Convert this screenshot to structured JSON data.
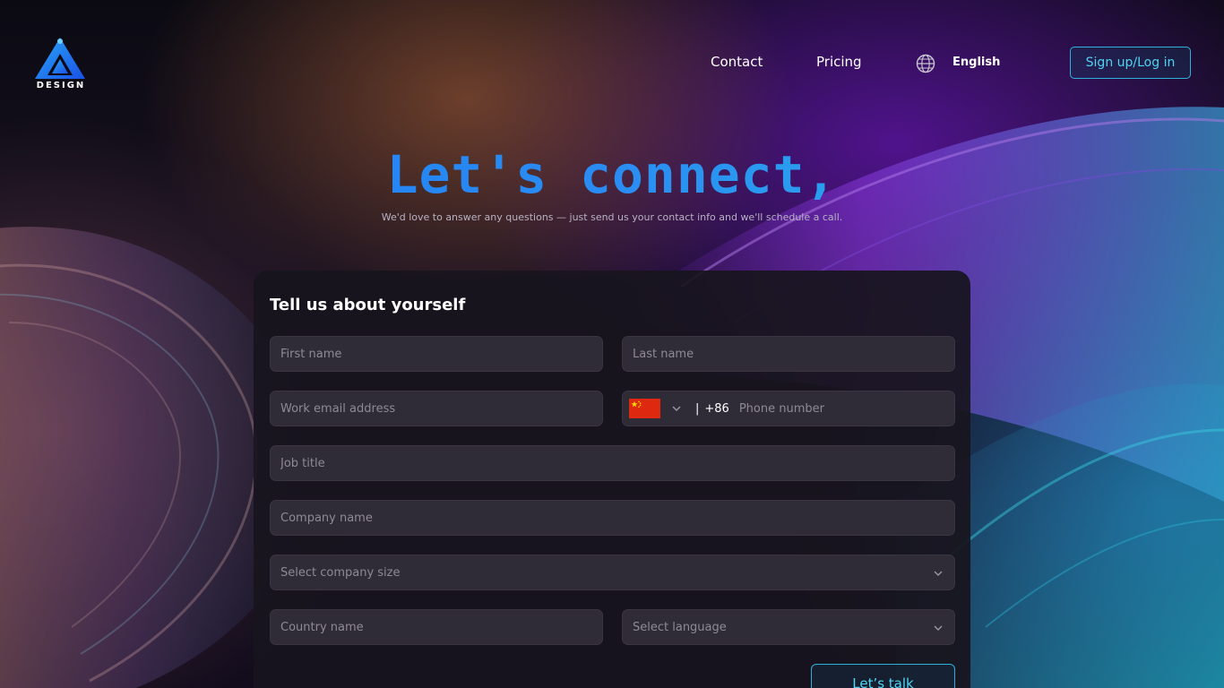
{
  "brand": {
    "logo_text": "DESIGN"
  },
  "nav": {
    "contact_label": "Contact",
    "pricing_label": "Pricing",
    "language_label": "English",
    "signup_label": "Sign up/Log in"
  },
  "hero": {
    "title": "Let's connect,",
    "subtitle": "We'd love to answer any questions — just send us your contact info and we'll schedule a call."
  },
  "form": {
    "title": "Tell us about yourself",
    "first_name_placeholder": "First name",
    "last_name_placeholder": "Last name",
    "email_placeholder": "Work email address",
    "phone_separator": "|",
    "phone_code": "+86",
    "phone_placeholder": "Phone number",
    "job_title_placeholder": "Job title",
    "company_name_placeholder": "Company name",
    "company_size_placeholder": "Select company size",
    "country_placeholder": "Country name",
    "language_placeholder": "Select language",
    "submit_label": "Let’s talk"
  },
  "icons": {
    "logo": "triangle-logo-icon",
    "globe": "globe-icon",
    "flag": "china-flag-icon",
    "chevron": "chevron-down-icon"
  },
  "colors": {
    "accent": "#2fb2d9",
    "title_gradient_start": "#1e7bf5",
    "title_gradient_end": "#2ac0e6",
    "card_bg": "#18141e",
    "field_bg": "#302c37",
    "flag_red": "#de2910",
    "flag_yellow": "#ffde00"
  }
}
